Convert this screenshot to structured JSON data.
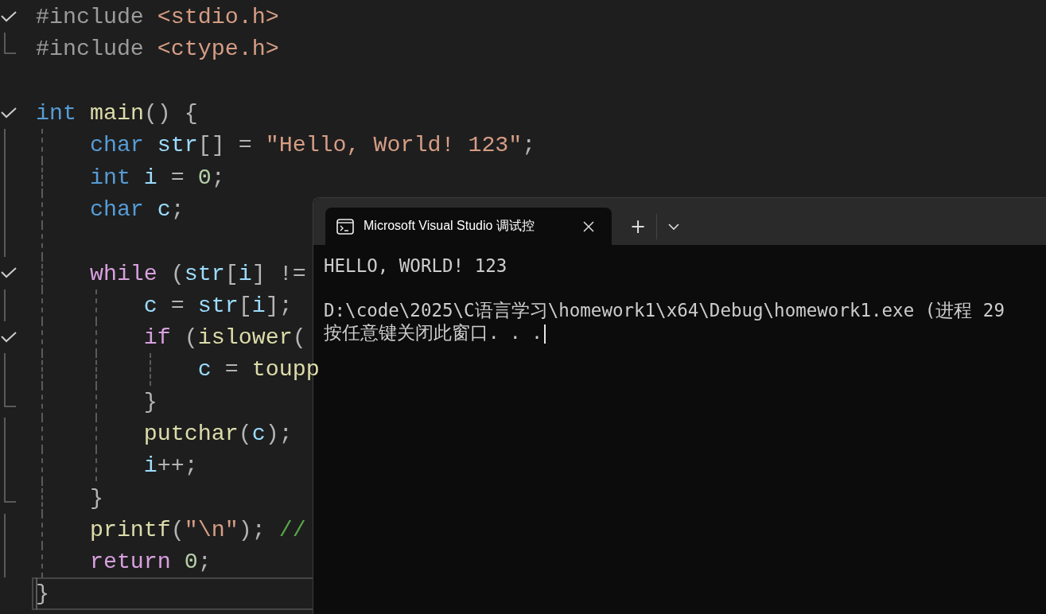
{
  "editor": {
    "lines": [
      {
        "kind": "start",
        "expanded": true,
        "tokens": [
          {
            "kind": "preproc",
            "text": "#include "
          },
          {
            "kind": "header",
            "text": "<stdio.h>"
          }
        ]
      },
      {
        "kind": "end",
        "tokens": [
          {
            "kind": "preproc",
            "text": "#include "
          },
          {
            "kind": "header",
            "text": "<ctype.h>"
          }
        ]
      },
      {
        "kind": "plain"
      },
      {
        "kind": "start",
        "expanded": true,
        "tokens": [
          {
            "kind": "keyword",
            "text": "int "
          },
          {
            "kind": "function",
            "text": "main"
          },
          {
            "kind": "punct",
            "text": "() {"
          }
        ]
      },
      {
        "kind": "body",
        "tokens": [
          {
            "kind": "keyword",
            "text": "    char "
          },
          {
            "kind": "variable",
            "text": "str"
          },
          {
            "kind": "punct",
            "text": "[] = "
          },
          {
            "kind": "string",
            "text": "\"Hello, World! 123\""
          },
          {
            "kind": "punct",
            "text": ";"
          }
        ]
      },
      {
        "kind": "body",
        "tokens": [
          {
            "kind": "keyword",
            "text": "    int "
          },
          {
            "kind": "variable",
            "text": "i"
          },
          {
            "kind": "punct",
            "text": " = "
          },
          {
            "kind": "number",
            "text": "0"
          },
          {
            "kind": "punct",
            "text": ";"
          }
        ]
      },
      {
        "kind": "body",
        "tokens": [
          {
            "kind": "keyword",
            "text": "    char "
          },
          {
            "kind": "variable",
            "text": "c"
          },
          {
            "kind": "punct",
            "text": ";"
          }
        ]
      },
      {
        "kind": "body"
      },
      {
        "kind": "start",
        "expanded": true,
        "tokens": [
          {
            "kind": "control",
            "text": "    while "
          },
          {
            "kind": "punct",
            "text": "("
          },
          {
            "kind": "variable",
            "text": "str"
          },
          {
            "kind": "punct",
            "text": "["
          },
          {
            "kind": "variable",
            "text": "i"
          },
          {
            "kind": "punct",
            "text": "] !="
          }
        ]
      },
      {
        "kind": "body",
        "tokens": [
          {
            "kind": "variable",
            "text": "        c"
          },
          {
            "kind": "punct",
            "text": " = "
          },
          {
            "kind": "variable",
            "text": "str"
          },
          {
            "kind": "punct",
            "text": "["
          },
          {
            "kind": "variable",
            "text": "i"
          },
          {
            "kind": "punct",
            "text": "];"
          }
        ]
      },
      {
        "kind": "start",
        "expanded": true,
        "tokens": [
          {
            "kind": "control",
            "text": "        if "
          },
          {
            "kind": "punct",
            "text": "("
          },
          {
            "kind": "function",
            "text": "islower"
          },
          {
            "kind": "punct",
            "text": "("
          }
        ]
      },
      {
        "kind": "body",
        "tokens": [
          {
            "kind": "variable",
            "text": "            c"
          },
          {
            "kind": "punct",
            "text": " = "
          },
          {
            "kind": "function",
            "text": "toupp"
          }
        ]
      },
      {
        "kind": "end",
        "tokens": [
          {
            "kind": "punct",
            "text": "        }"
          }
        ]
      },
      {
        "kind": "body",
        "tokens": [
          {
            "kind": "function",
            "text": "        putchar"
          },
          {
            "kind": "punct",
            "text": "("
          },
          {
            "kind": "variable",
            "text": "c"
          },
          {
            "kind": "punct",
            "text": ");"
          }
        ]
      },
      {
        "kind": "body",
        "tokens": [
          {
            "kind": "variable",
            "text": "        i"
          },
          {
            "kind": "punct",
            "text": "++;"
          }
        ]
      },
      {
        "kind": "end",
        "tokens": [
          {
            "kind": "punct",
            "text": "    }"
          }
        ]
      },
      {
        "kind": "body",
        "tokens": [
          {
            "kind": "function",
            "text": "    printf"
          },
          {
            "kind": "punct",
            "text": "("
          },
          {
            "kind": "string",
            "text": "\"\\n\""
          },
          {
            "kind": "punct",
            "text": "); "
          },
          {
            "kind": "comment",
            "text": "//"
          }
        ]
      },
      {
        "kind": "body",
        "tokens": [
          {
            "kind": "control",
            "text": "    return "
          },
          {
            "kind": "number",
            "text": "0"
          },
          {
            "kind": "punct",
            "text": ";"
          }
        ]
      },
      {
        "kind": "body",
        "current": true,
        "tokens": [
          {
            "kind": "punct",
            "text": "}"
          }
        ]
      }
    ]
  },
  "terminal": {
    "tab": {
      "title": "Microsoft Visual Studio 调试控",
      "selected": true
    },
    "new_tab": "+",
    "output": [
      {
        "kind": "text",
        "text": "HELLO, WORLD! 123"
      },
      {
        "kind": "blank"
      },
      {
        "kind": "text",
        "text": "D:\\code\\2025\\C语言学习\\homework1\\x64\\Debug\\homework1.exe (进程 29"
      },
      {
        "kind": "text",
        "text": "按任意键关闭此窗口. . .",
        "cursor": true
      }
    ]
  }
}
